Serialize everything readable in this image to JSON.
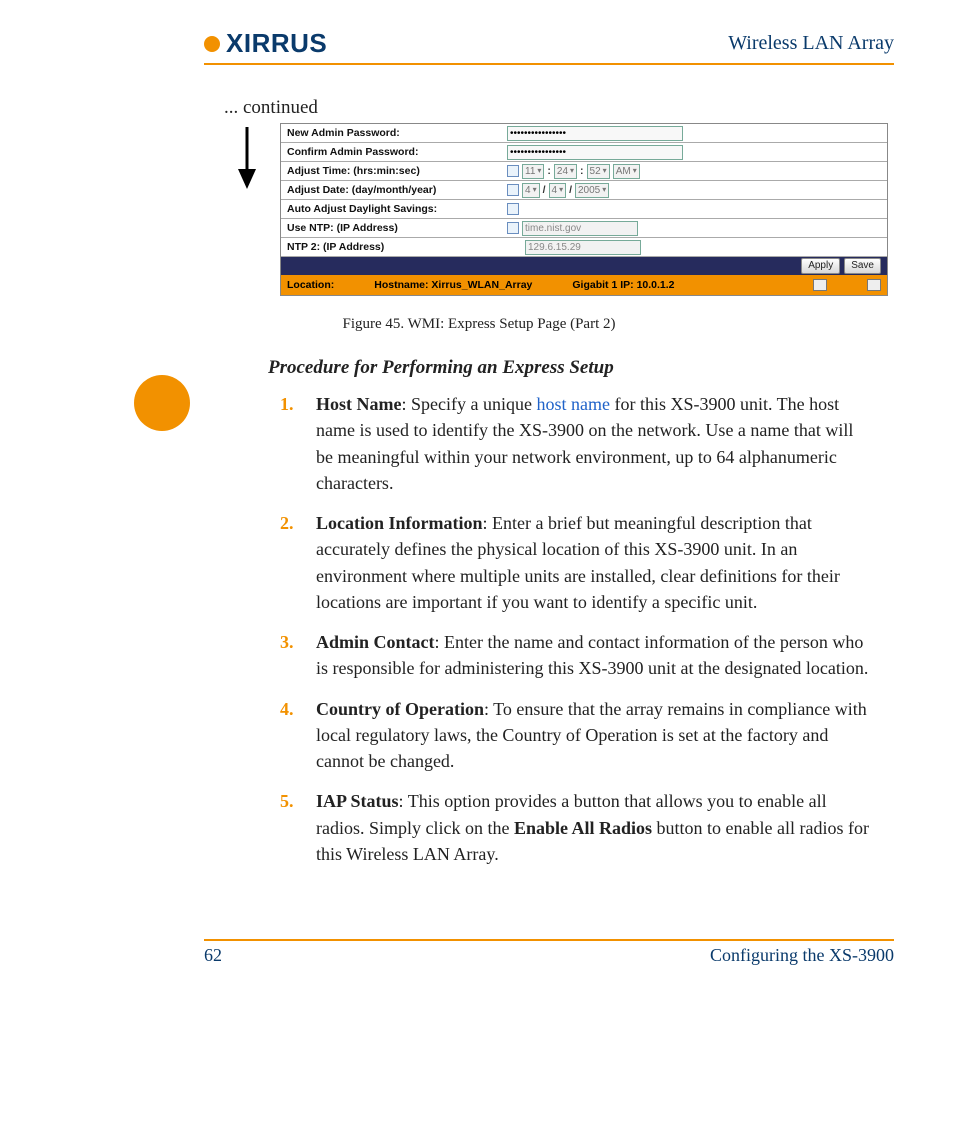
{
  "header": {
    "logo_text": "XIRRUS",
    "doc_title": "Wireless LAN Array"
  },
  "continued_label": "... continued",
  "figure": {
    "caption": "Figure 45. WMI: Express Setup Page (Part 2)",
    "rows": {
      "new_pw_label": "New Admin Password:",
      "new_pw_value": "●●●●●●●●●●●●●●●●",
      "confirm_pw_label": "Confirm Admin Password:",
      "confirm_pw_value": "●●●●●●●●●●●●●●●●",
      "adjust_time_label": "Adjust Time: (hrs:min:sec)",
      "time_h": "11",
      "time_m": "24",
      "time_s": "52",
      "time_ampm": "AM",
      "adjust_date_label": "Adjust Date: (day/month/year)",
      "date_d": "4",
      "date_m": "4",
      "date_y": "2005",
      "dst_label": "Auto Adjust Daylight Savings:",
      "ntp_label": "Use NTP: (IP Address)",
      "ntp_value": "time.nist.gov",
      "ntp2_label": "NTP 2: (IP Address)",
      "ntp2_value": "129.6.15.29"
    },
    "buttons": {
      "apply": "Apply",
      "save": "Save"
    },
    "status": {
      "location_label": "Location:",
      "hostname": "Hostname: Xirrus_WLAN_Array",
      "gig": "Gigabit 1 IP: 10.0.1.2"
    }
  },
  "section_heading": "Procedure for Performing an Express Setup",
  "steps": [
    {
      "term": "Host Name",
      "pre": ": Specify a unique ",
      "link": "host name",
      "post": " for this XS-3900 unit. The host name is used to identify the XS-3900 on the network. Use a name that will be meaningful within your network environment, up to 64 alphanumeric characters."
    },
    {
      "term": "Location Information",
      "body": ": Enter a brief but meaningful description that accurately defines the physical location of this XS-3900 unit. In an environment where multiple units are installed, clear definitions for their locations are important if you want to identify a specific unit."
    },
    {
      "term": "Admin Contact",
      "body": ": Enter the name and contact information of the person who is responsible for administering this XS-3900 unit at the designated location."
    },
    {
      "term": "Country of Operation",
      "body": ": To ensure that the array remains in compliance with local regulatory laws, the Country of Operation is set at the factory and cannot be changed."
    },
    {
      "term": "IAP Status",
      "pre": ": This option provides a button that allows you to enable all radios. Simply click on the ",
      "bold": "Enable All Radios",
      "post": " button to enable all radios for this Wireless LAN Array."
    }
  ],
  "footer": {
    "page_number": "62",
    "section_title": "Configuring the XS-3900"
  }
}
